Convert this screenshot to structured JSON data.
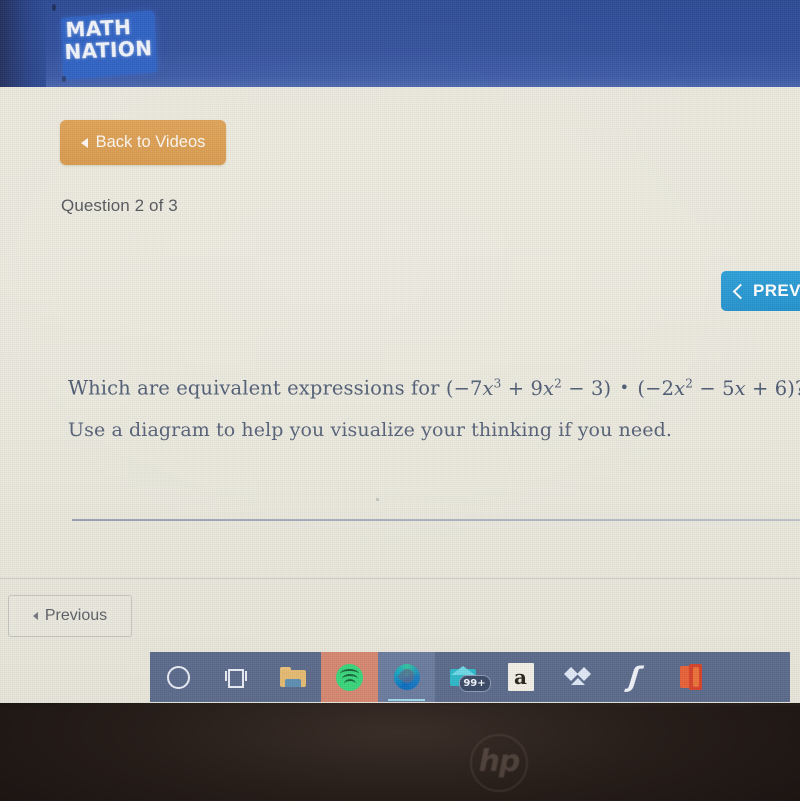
{
  "app": {
    "name": "Math Nation",
    "logo_line1": "MATH",
    "logo_line2": "NATION",
    "header_color": "#32509b",
    "logo_flag_color": "#2f62c4"
  },
  "toolbar": {
    "back_to_videos_label": "Back to Videos",
    "back_to_videos_color": "#dda054",
    "back_icon": "triangle-left-icon"
  },
  "progress": {
    "counter_label": "Question 2 of 3",
    "current": 2,
    "total": 3
  },
  "nav": {
    "prev_top_label": "PREV",
    "prev_top_color": "#2998d4",
    "prev_top_icon": "chevron-left-icon",
    "prev_bottom_label": "Previous",
    "prev_bottom_icon": "triangle-left-icon"
  },
  "question": {
    "line1_prefix": "Which are equivalent expressions for",
    "expression": {
      "open1": "(",
      "t1_coef": "−7",
      "t1_var": "x",
      "t1_exp": "3",
      "op1": "+",
      "t2_coef": "9",
      "t2_var": "x",
      "t2_exp": "2",
      "op2": "−",
      "t3": "3",
      "close1": ")",
      "times": "•",
      "open2": "(",
      "t4_coef": "−2",
      "t4_var": "x",
      "t4_exp": "2",
      "op3": "−",
      "t5_coef": "5",
      "t5_var": "x",
      "op4": "+",
      "t6": "6",
      "close2": ")",
      "question_mark": "?",
      "plain_text": "(−7x³ + 9x² − 3) • (−2x² − 5x + 6)?"
    },
    "line2": "Use a diagram to help you visualize your thinking if you need.",
    "text_color": "#4c5a72"
  },
  "taskbar": {
    "background_color": "#5d6b8c",
    "items": [
      {
        "name": "cortana",
        "icon": "circle-icon",
        "label": "Cortana",
        "highlight": "none"
      },
      {
        "name": "task-view",
        "icon": "task-view-icon",
        "label": "Task View",
        "highlight": "none"
      },
      {
        "name": "file-explorer",
        "icon": "folder-icon",
        "label": "File Explorer",
        "highlight": "none"
      },
      {
        "name": "spotify",
        "icon": "spotify-icon",
        "label": "Spotify",
        "highlight": "#d58871"
      },
      {
        "name": "microsoft-edge",
        "icon": "edge-icon",
        "label": "Microsoft Edge",
        "highlight": "#6c7c9e"
      },
      {
        "name": "mail",
        "icon": "mail-icon",
        "label": "Mail",
        "highlight": "none",
        "badge": "99+"
      },
      {
        "name": "amazon",
        "icon": "amazon-icon",
        "label": "Amazon",
        "highlight": "none",
        "glyph": "a"
      },
      {
        "name": "dropbox",
        "icon": "dropbox-icon",
        "label": "Dropbox",
        "highlight": "none"
      },
      {
        "name": "lightning-app",
        "icon": "lightning-bolt-icon",
        "label": "Lightning",
        "highlight": "none",
        "glyph": "ʃ"
      },
      {
        "name": "microsoft-office",
        "icon": "office-icon",
        "label": "Microsoft Office",
        "highlight": "none"
      }
    ]
  },
  "device": {
    "brand_logo": "hp",
    "bezel_color": "#241c18"
  }
}
